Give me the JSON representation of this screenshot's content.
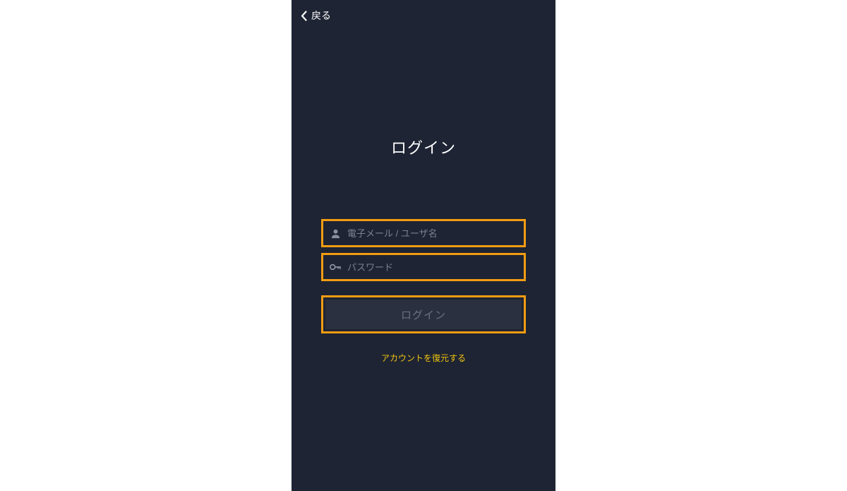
{
  "header": {
    "back_label": "戻る"
  },
  "login": {
    "heading": "ログイン",
    "email_placeholder": "電子メール / ユーザ名",
    "password_placeholder": "パスワード",
    "button_label": "ログイン",
    "recover_label": "アカウントを復元する"
  },
  "colors": {
    "accent": "#f39c12",
    "background": "#1e2433",
    "link": "#f1c40f"
  }
}
